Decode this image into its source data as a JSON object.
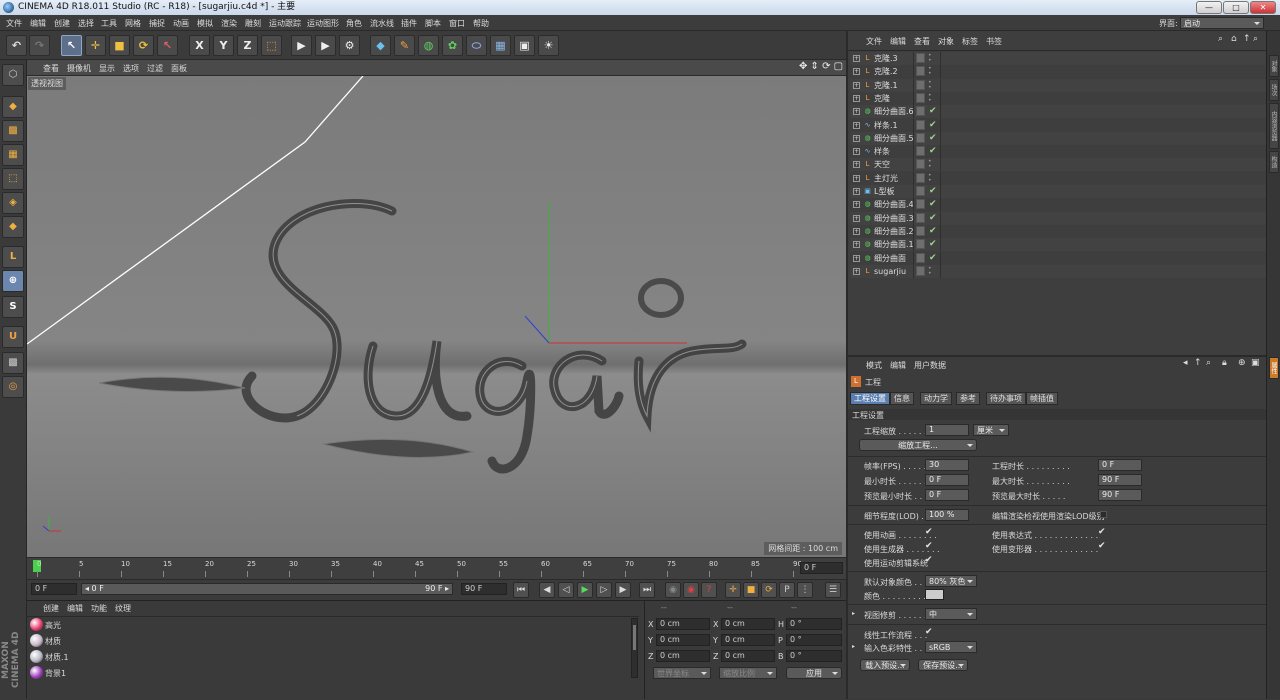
{
  "window": {
    "title": "CINEMA 4D R18.011 Studio (RC - R18) - [sugarjiu.c4d *] - 主要",
    "btn_min": "—",
    "btn_max": "□",
    "btn_close": "✕"
  },
  "menu": {
    "items": [
      "文件",
      "编辑",
      "创建",
      "选择",
      "工具",
      "网格",
      "捕捉",
      "动画",
      "模拟",
      "渲染",
      "雕刻",
      "运动跟踪",
      "运动图形",
      "角色",
      "流水线",
      "插件",
      "脚本",
      "窗口",
      "帮助"
    ],
    "layout_label": "界面:",
    "layout_value": "启动"
  },
  "viewport": {
    "menu": [
      "查看",
      "摄像机",
      "显示",
      "选项",
      "过滤",
      "面板"
    ],
    "view_name": "透视视图",
    "grid_spacing": "网格间距 : 100 cm",
    "nav_icons": "✥ ⇕ ⟳ ▢"
  },
  "timeline": {
    "ticks": [
      "0",
      "5",
      "10",
      "15",
      "20",
      "25",
      "30",
      "35",
      "40",
      "45",
      "50",
      "55",
      "60",
      "65",
      "70",
      "75",
      "80",
      "85",
      "90"
    ],
    "end_frame": "0 F"
  },
  "playback": {
    "start_field": "0 F",
    "range_start": "◂ 0 F",
    "range_end": "90 F ▸",
    "end_field": "90 F"
  },
  "material_manager": {
    "menu": [
      "创建",
      "编辑",
      "功能",
      "纹理"
    ],
    "materials": [
      {
        "name": "高光",
        "color": "#e84070"
      },
      {
        "name": "材质",
        "color": "#c8b8c8"
      },
      {
        "name": "材质.1",
        "color": "#b8b8c8"
      },
      {
        "name": "背景1",
        "color": "#a040c0"
      }
    ]
  },
  "coord_manager": {
    "headers": [
      "--",
      "--",
      "--"
    ],
    "rows": [
      {
        "a": "X",
        "v1": "0 cm",
        "b": "X",
        "v2": "0 cm",
        "c": "H",
        "v3": "0 °"
      },
      {
        "a": "Y",
        "v1": "0 cm",
        "b": "Y",
        "v2": "0 cm",
        "c": "P",
        "v3": "0 °"
      },
      {
        "a": "Z",
        "v1": "0 cm",
        "b": "Z",
        "v2": "0 cm",
        "c": "B",
        "v3": "0 °"
      }
    ],
    "world": "世界坐标",
    "scale": "缩放比例",
    "apply": "应用"
  },
  "object_manager": {
    "menu": [
      "文件",
      "编辑",
      "查看",
      "对象",
      "标签",
      "书签"
    ],
    "objects": [
      {
        "name": "克隆.3",
        "icon": "L",
        "kind": "cloner"
      },
      {
        "name": "克隆.2",
        "icon": "L",
        "kind": "cloner"
      },
      {
        "name": "克隆.1",
        "icon": "L",
        "kind": "cloner"
      },
      {
        "name": "克隆",
        "icon": "L",
        "kind": "cloner"
      },
      {
        "name": "细分曲面.6",
        "icon": "◍",
        "kind": "subd"
      },
      {
        "name": "样条.1",
        "icon": "∿",
        "kind": "spline"
      },
      {
        "name": "细分曲面.5",
        "icon": "◍",
        "kind": "subd"
      },
      {
        "name": "样条",
        "icon": "∿",
        "kind": "spline"
      },
      {
        "name": "天空",
        "icon": "L",
        "kind": "null"
      },
      {
        "name": "主灯光",
        "icon": "L",
        "kind": "null"
      },
      {
        "name": "L型板",
        "icon": "▣",
        "kind": "cube"
      },
      {
        "name": "细分曲面.4",
        "icon": "◍",
        "kind": "subd"
      },
      {
        "name": "细分曲面.3",
        "icon": "◍",
        "kind": "subd"
      },
      {
        "name": "细分曲面.2",
        "icon": "◍",
        "kind": "subd"
      },
      {
        "name": "细分曲面.1",
        "icon": "◍",
        "kind": "subd"
      },
      {
        "name": "细分曲面",
        "icon": "◍",
        "kind": "subd"
      },
      {
        "name": "sugarjiu",
        "icon": "L",
        "kind": "null"
      }
    ]
  },
  "right_tabs": [
    "对象",
    "场次",
    "内容浏览器",
    "构造"
  ],
  "right_tabs_lower": [
    "属性"
  ],
  "attributes": {
    "menu": [
      "模式",
      "编辑",
      "用户数据"
    ],
    "title": "工程",
    "tabs": [
      "工程设置",
      "信息",
      "动力学",
      "参考",
      "待办事项",
      "帧插值"
    ],
    "section": "工程设置",
    "scale_label": "工程缩放 . . . . . .",
    "scale_value": "1",
    "scale_unit": "厘米",
    "scale_button": "缩放工程...",
    "fps_label": "帧率(FPS) . . . . . .",
    "fps_value": "30",
    "proj_len_label": "工程时长 . . . . . . . . .",
    "proj_len_value": "0 F",
    "min_len_label": "最小时长 . . . . . . .",
    "min_len_value": "0 F",
    "max_len_label": "最大时长 . . . . . . . . .",
    "max_len_value": "90 F",
    "prev_min_label": "预览最小时长 . . .",
    "prev_min_value": "0 F",
    "prev_max_label": "预览最大时长 . . . . .",
    "prev_max_value": "90 F",
    "lod_label": "细节程度(LOD) . . .",
    "lod_value": "100 %",
    "lod_render_label": "编辑渲染检视使用渲染LOD级别",
    "use_anim": "使用动画 . . . . . . . .",
    "use_expr": "使用表达式 . . . . . . . . . . . . .",
    "use_gen": "使用生成器 . . . . . . .",
    "use_deform": "使用变形器 . . . . . . . . . . . . .",
    "use_motion": "使用运动剪辑系统",
    "default_color_label": "默认对象颜色 . . .",
    "default_color_value": "80% 灰色",
    "color_label": "颜色 . . . . . . . . . .",
    "view_clip_label": "视图修剪 . . . . . . .",
    "view_clip_value": "中",
    "linear_label": "线性工作流程 . . .",
    "input_profile_label": "输入色彩特性 . . .",
    "input_profile_value": "sRGB",
    "load_preset": "载入预设...",
    "save_preset": "保存预设..."
  },
  "colors": {
    "accent": "#5a7eb0",
    "check": "#9fd58a",
    "bg": "#3a3a3a"
  }
}
